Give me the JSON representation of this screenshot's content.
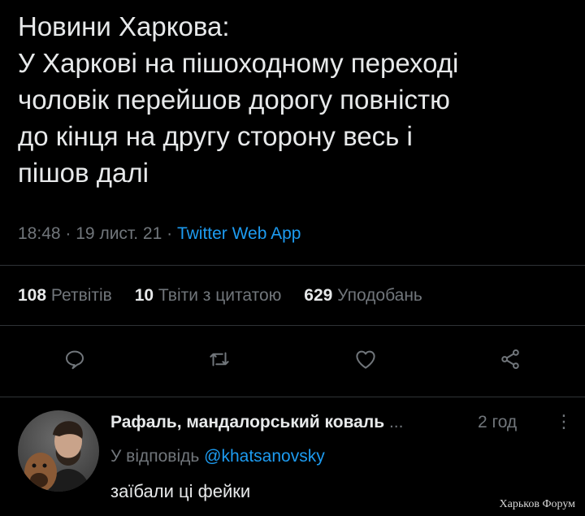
{
  "tweet": {
    "lines": [
      "Новини Харкова:",
      "У Харкові на пішоходному переході",
      "чоловік перейшов дорогу повністю",
      "до кінця на другу сторону весь і",
      "пішов далі"
    ],
    "time": "18:48",
    "date": "19 лист. 21",
    "source": "Twitter Web App",
    "separator": "·"
  },
  "stats": {
    "retweets_count": "108",
    "retweets_label": "Ретвітів",
    "quotes_count": "10",
    "quotes_label": "Твіти з цитатою",
    "likes_count": "629",
    "likes_label": "Уподобань"
  },
  "actions": {
    "icons": [
      "reply-icon",
      "retweet-icon",
      "like-icon",
      "share-icon"
    ]
  },
  "reply": {
    "author": "Рафаль, мандалорський коваль",
    "ellipsis": "...",
    "time": "2 год",
    "more": "⋮",
    "replying_label": "У відповідь",
    "replying_handle": "@khatsanovsky",
    "text": "заїбали ці фейки"
  },
  "watermark": "Харьков Форум",
  "colors": {
    "background": "#000000",
    "text": "#e7e9ea",
    "muted": "#71767b",
    "accent": "#1d9bf0",
    "divider": "#2f3336"
  }
}
